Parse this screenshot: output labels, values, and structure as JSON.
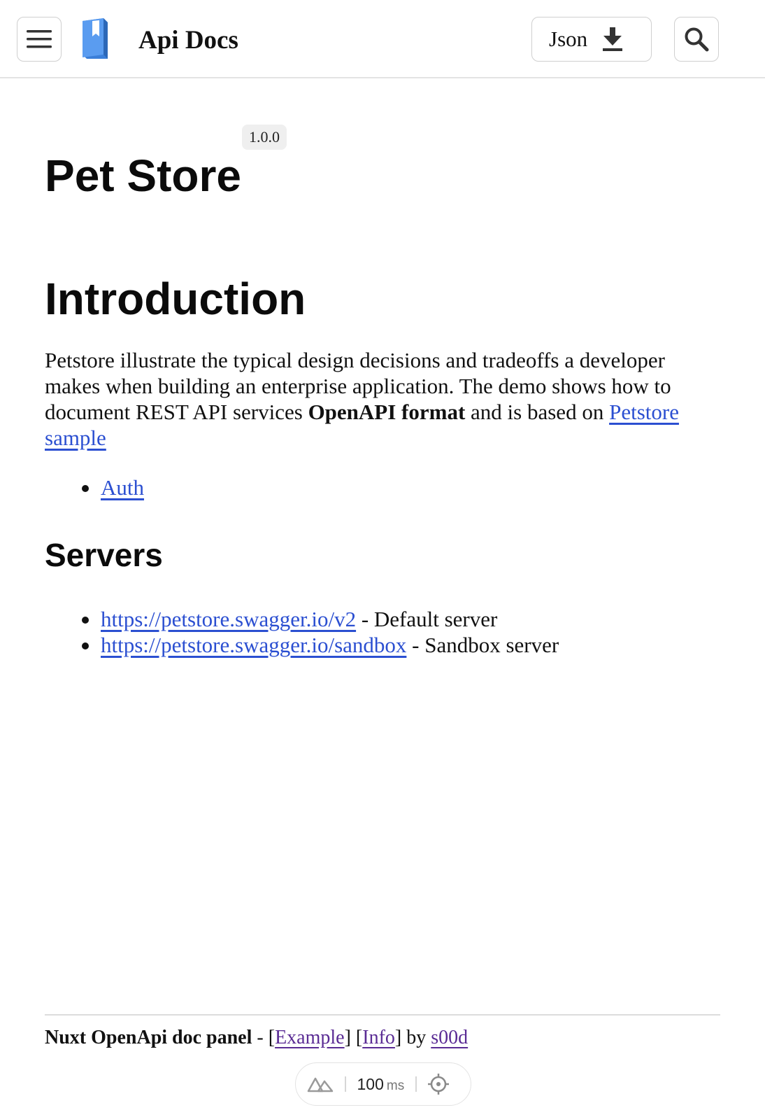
{
  "header": {
    "title": "Api Docs",
    "menu_icon": "hamburger-menu-icon",
    "logo_icon": "book-icon",
    "json_button_label": "Json",
    "json_button_icon": "download-icon",
    "search_icon": "search-icon"
  },
  "api": {
    "title": "Pet Store",
    "version": "1.0.0"
  },
  "introduction": {
    "heading": "Introduction",
    "text_part1": "Petstore illustrate the typical design decisions and tradeoffs a developer makes when building an enterprise application. The demo shows how to document REST API services ",
    "bold_text": "OpenAPI format",
    "text_part2": " and is based on ",
    "link_text": "Petstore sample",
    "items": [
      {
        "label": "Auth"
      }
    ]
  },
  "servers": {
    "heading": "Servers",
    "items": [
      {
        "url": "https://petstore.swagger.io/v2",
        "description": " - Default server"
      },
      {
        "url": "https://petstore.swagger.io/sandbox",
        "description": " - Sandbox server"
      }
    ]
  },
  "footer": {
    "app_name": "Nuxt OpenApi doc panel",
    "dash": " - [",
    "example_link": "Example",
    "mid": "] [",
    "info_link": "Info",
    "by_text": "] by ",
    "author_link": "s00d"
  },
  "devbar": {
    "logo_icon": "nuxt-logo-icon",
    "value": "100",
    "unit": "ms",
    "target_icon": "crosshair-icon"
  },
  "colors": {
    "link": "#2b4fd1",
    "visited_link": "#5a2b94",
    "logo_blue": "#4a8fe7",
    "border": "#cfcfcf"
  }
}
